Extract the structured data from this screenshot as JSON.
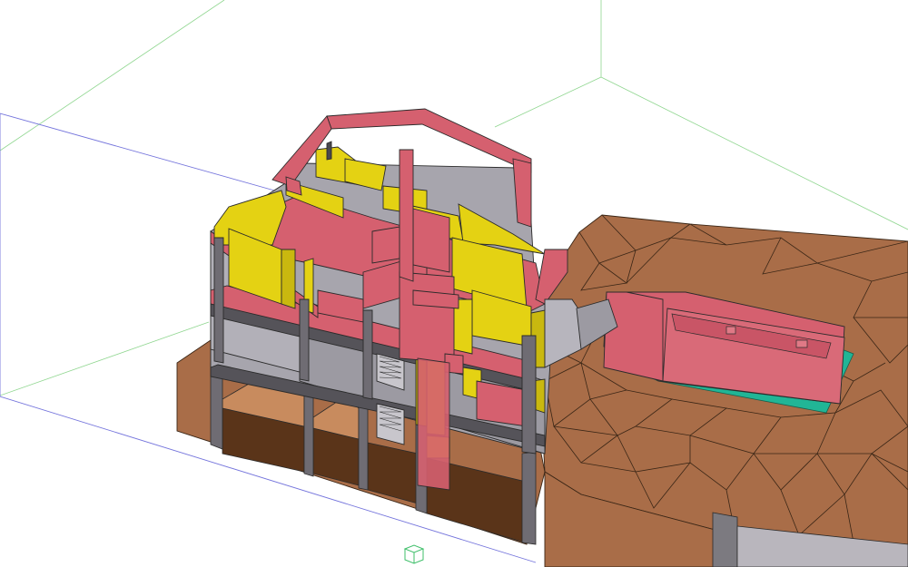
{
  "viewport": {
    "view": "3D",
    "background_color": "#ffffff",
    "grid_line_color": "#7fd07f",
    "axis_line_color": "#6a6ad8",
    "colors": {
      "terrain": "#a96d48",
      "terrain_dark": "#6b3e22",
      "terrain_mesh": "#3a2616",
      "section_cut": "#d5606f",
      "slab": "#d5606f",
      "walls_interior": "#e4d213",
      "walls_gray": "#a7a5ad",
      "terrace_base": "#21b596",
      "outline": "#2b2b2b"
    },
    "icons": [
      "navigation-cube-icon"
    ]
  }
}
